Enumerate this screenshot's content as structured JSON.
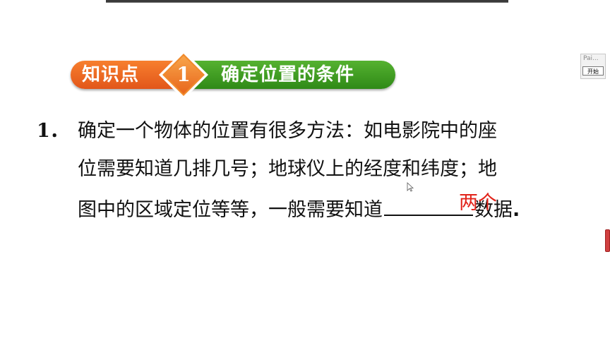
{
  "banner": {
    "label": "知识点",
    "number": "1",
    "topic": "确定位置的条件",
    "colors": {
      "orange": "#ee6a22",
      "green": "#3f9d22",
      "diamond": "#f08a2c"
    }
  },
  "question": {
    "number": "1．",
    "line1": "确定一个物体的位置有很多方法：如电影院中的座",
    "line2": "位需要知道几排几号；地球仪上的经度和纬度；地",
    "line3_prefix": "图中的区域定位等等，一般需要知道",
    "line3_suffix": "数据",
    "line3_end": ".",
    "answer": "两个",
    "answer_color": "#e2231a"
  },
  "widget": {
    "label": "Pai...",
    "button": "开始"
  },
  "icons": {
    "cursor": "mouse-pointer-icon"
  }
}
